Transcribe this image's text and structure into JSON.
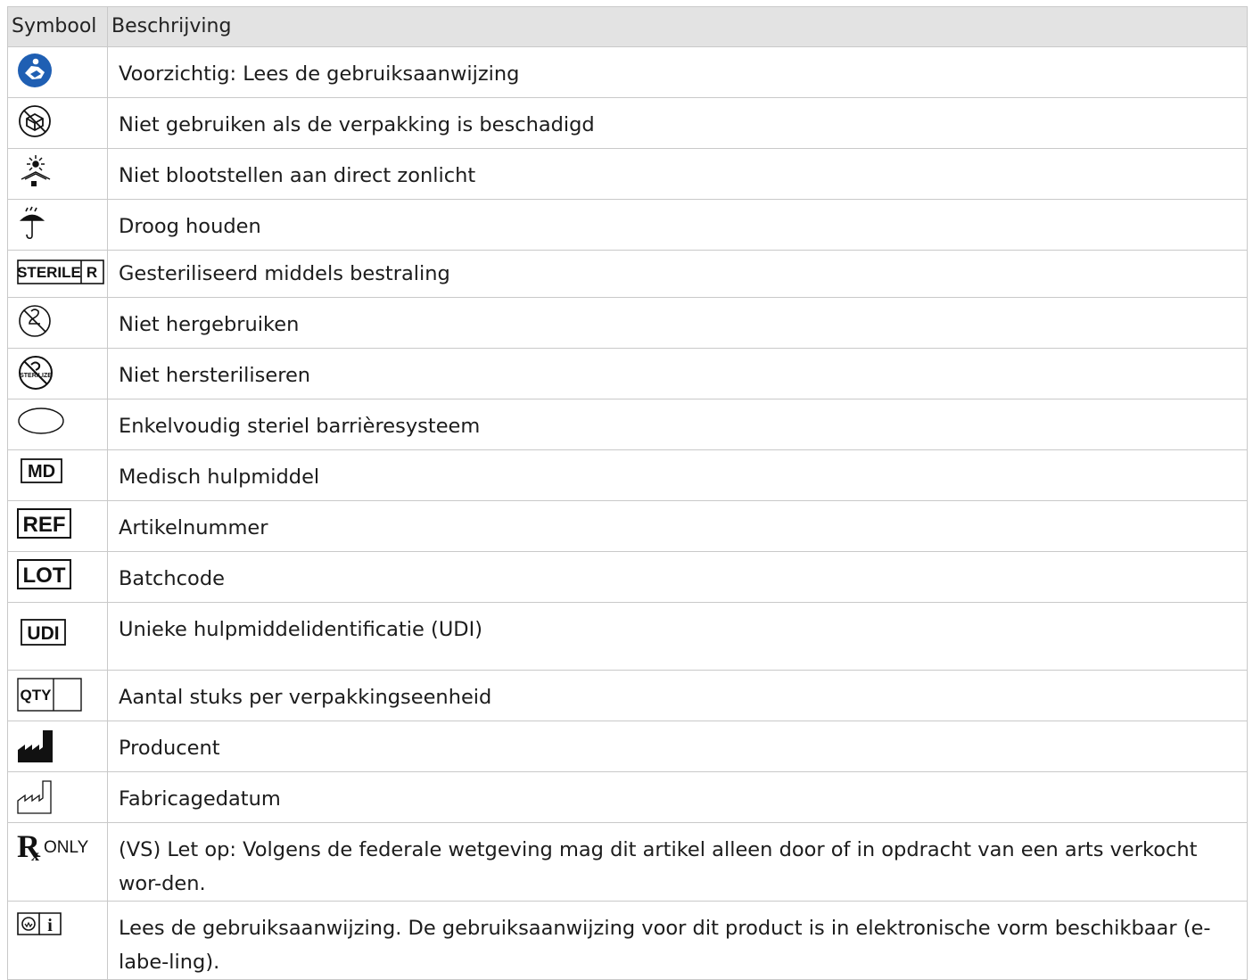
{
  "table": {
    "headers": {
      "symbol": "Symbool",
      "description": "Beschrijving"
    },
    "rows": [
      {
        "icon": "consult-ifu-icon",
        "description": "Voorzichtig: Lees de gebruiksaanwijzing"
      },
      {
        "icon": "do-not-use-if-damaged-icon",
        "description": "Niet gebruiken als de verpakking is beschadigd"
      },
      {
        "icon": "keep-away-from-sunlight-icon",
        "description": "Niet blootstellen aan direct zonlicht"
      },
      {
        "icon": "keep-dry-icon",
        "description": "Droog houden"
      },
      {
        "icon": "sterile-r-icon",
        "icon_text": [
          "STERILE",
          "R"
        ],
        "description": "Gesteriliseerd middels bestraling"
      },
      {
        "icon": "do-not-reuse-icon",
        "description": "Niet hergebruiken"
      },
      {
        "icon": "do-not-resterilize-icon",
        "icon_text": [
          "STERILIZE"
        ],
        "description": "Niet hersteriliseren"
      },
      {
        "icon": "single-sterile-barrier-icon",
        "description": "Enkelvoudig steriel barrièresysteem"
      },
      {
        "icon": "medical-device-icon",
        "icon_text": [
          "MD"
        ],
        "description": "Medisch hulpmiddel"
      },
      {
        "icon": "catalogue-number-icon",
        "icon_text": [
          "REF"
        ],
        "description": "Artikelnummer"
      },
      {
        "icon": "batch-code-icon",
        "icon_text": [
          "LOT"
        ],
        "description": "Batchcode"
      },
      {
        "icon": "udi-icon",
        "icon_text": [
          "UDI"
        ],
        "description": "Unieke hulpmiddelidentificatie (UDI)"
      },
      {
        "icon": "quantity-icon",
        "icon_text": [
          "QTY"
        ],
        "description": "Aantal stuks per verpakkingseenheid"
      },
      {
        "icon": "manufacturer-icon",
        "description": "Producent"
      },
      {
        "icon": "date-of-manufacture-icon",
        "description": "Fabricagedatum"
      },
      {
        "icon": "rx-only-icon",
        "icon_text": [
          "ONLY"
        ],
        "description": "(VS) Let op: Volgens de federale wetgeving mag dit artikel alleen door of in opdracht van een arts verkocht wor-den."
      },
      {
        "icon": "e-labeling-icon",
        "icon_text": [
          "i"
        ],
        "description": "Lees de gebruiksaanwijzing. De gebruiksaanwijzing voor dit product is in elektronische vorm beschikbaar (e-labe-ling)."
      }
    ]
  }
}
